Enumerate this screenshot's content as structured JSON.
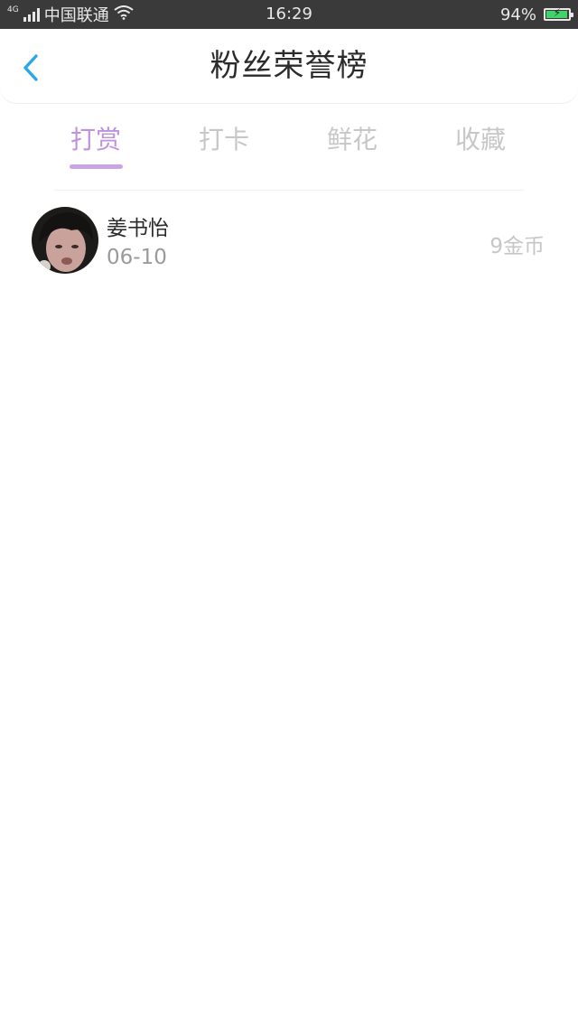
{
  "status_bar": {
    "network_type": "4G",
    "carrier": "中国联通",
    "time": "16:29",
    "battery_percent": "94%",
    "battery_level": 0.94
  },
  "header": {
    "title": "粉丝荣誉榜",
    "back_icon": "chevron-left-icon",
    "accent_color": "#2aa7e8"
  },
  "tabs": [
    {
      "label": "打赏",
      "active": true
    },
    {
      "label": "打卡",
      "active": false
    },
    {
      "label": "鲜花",
      "active": false
    },
    {
      "label": "收藏",
      "active": false
    }
  ],
  "tab_active_color": "#bf92df",
  "list": [
    {
      "name": "姜书怡",
      "date": "06-10",
      "amount": "9金币",
      "avatar": "user-avatar"
    }
  ]
}
